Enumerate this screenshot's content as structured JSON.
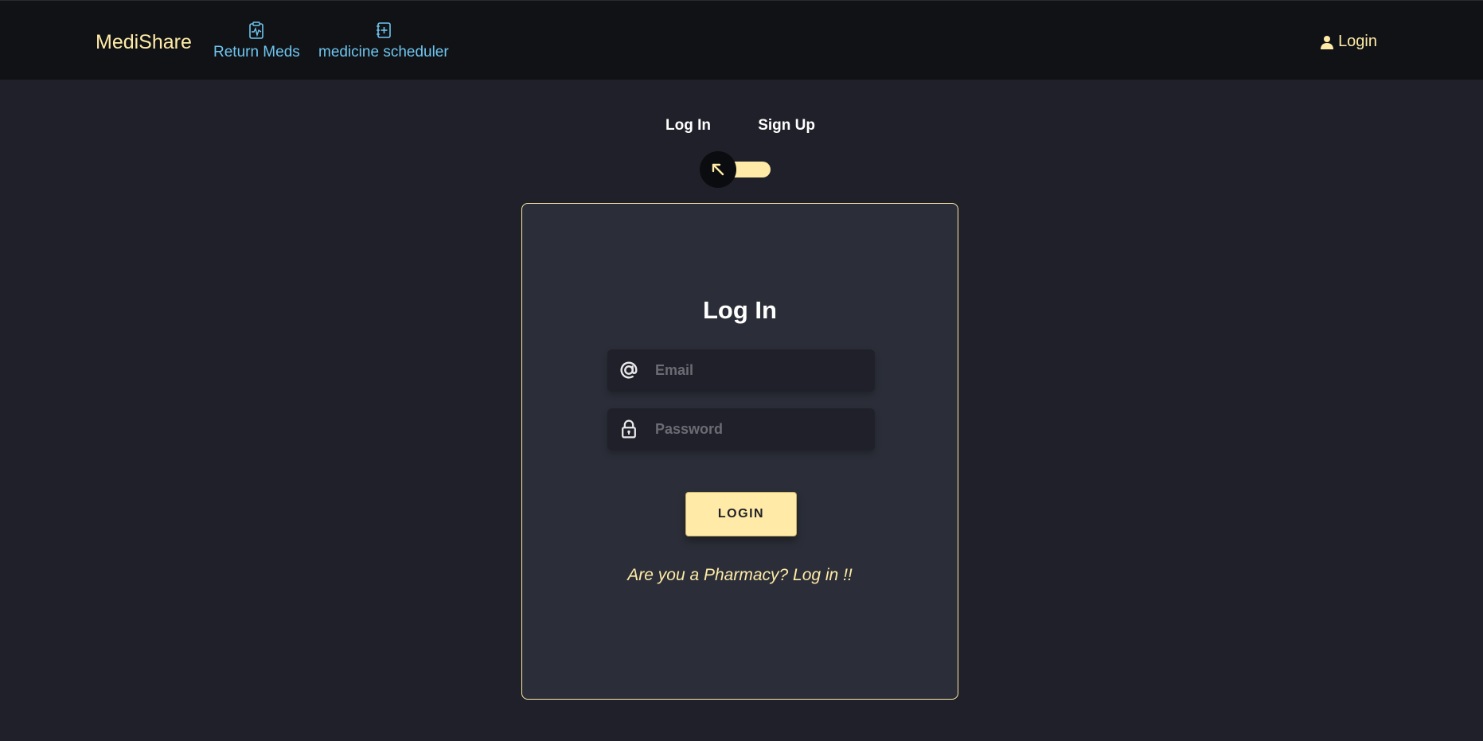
{
  "nav": {
    "brand": "MediShare",
    "items": [
      {
        "label": "Return Meds",
        "icon": "clipboard-pulse-icon"
      },
      {
        "label": "medicine scheduler",
        "icon": "journal-plus-icon"
      }
    ],
    "login": {
      "label": "Login",
      "icon": "user-icon"
    }
  },
  "switch": {
    "left_label": "Log In",
    "right_label": "Sign Up",
    "knob_icon": "arrow-up-left-icon"
  },
  "form": {
    "title": "Log In",
    "email_placeholder": "Email",
    "password_placeholder": "Password",
    "email_icon": "at-icon",
    "password_icon": "lock-icon",
    "submit_label": "LOGIN",
    "pharmacy_link": "Are you a Pharmacy? Log in !!"
  },
  "colors": {
    "background": "#1f2029",
    "navbar": "#111216",
    "accent": "#ffeba7",
    "nav_link": "#6ec6f0",
    "card": "#2b2e38"
  }
}
